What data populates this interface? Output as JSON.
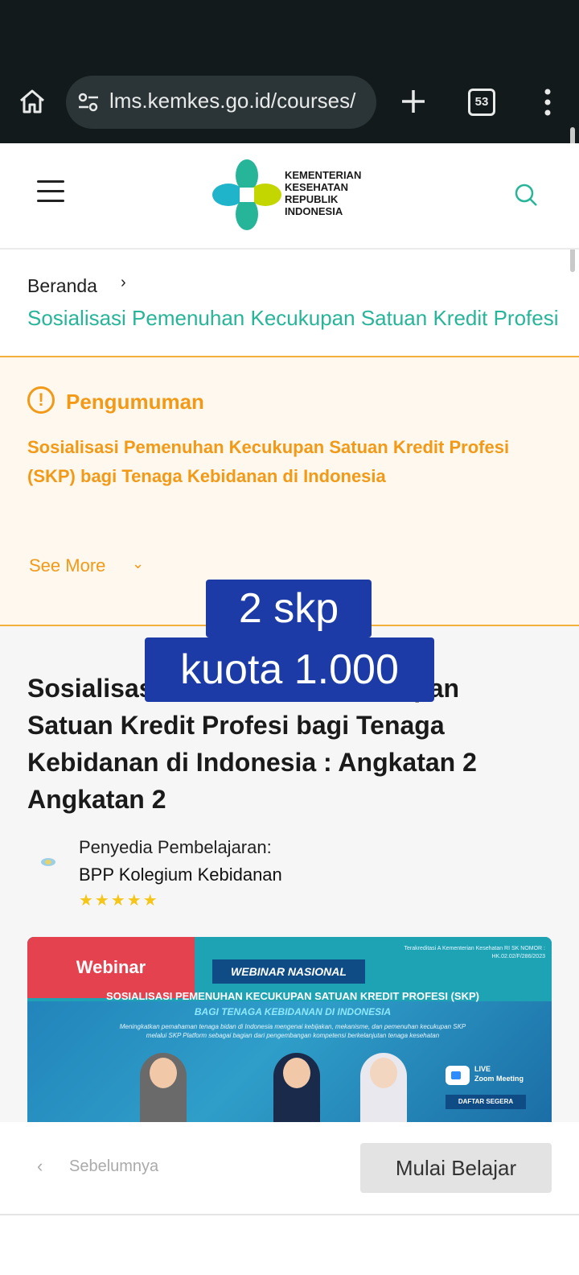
{
  "browser": {
    "url": "lms.kemkes.go.id/courses/",
    "tab_count": "53"
  },
  "header": {
    "logo_lines": [
      "KEMENTERIAN",
      "KESEHATAN",
      "REPUBLIK",
      "INDONESIA"
    ]
  },
  "breadcrumb": {
    "home": "Beranda",
    "current": "Sosialisasi Pemenuhan Kecukupan Satuan Kredit Profesi"
  },
  "announcement": {
    "title": "Pengumuman",
    "body": "Sosialisasi Pemenuhan Kecukupan Satuan Kredit Profesi (SKP) bagi Tenaga Kebidanan di Indonesia",
    "see_more": "See More"
  },
  "overlay": {
    "line1": "2 skp",
    "line2": "kuota 1.000"
  },
  "course": {
    "title": "Sosialisasi Pemenuhan Kecukupan Satuan Kredit Profesi bagi Tenaga Kebidanan di Indonesia : Angkatan 2 Angkatan 2",
    "provider_label": "Penyedia Pembelajaran:",
    "provider_name": "BPP Kolegium Kebidanan",
    "rating": 4.5,
    "rating_stars": "★★★★★"
  },
  "banner": {
    "badge": "Webinar",
    "headline": "WEBINAR NASIONAL",
    "accreditation": "Terakreditasi A Kementerian Kesehatan RI SK NOMOR : HK.02.02/F/286/2023",
    "subtitle": "SOSIALISASI PEMENUHAN KECUKUPAN SATUAN KREDIT PROFESI (SKP)",
    "subtitle2": "BAGI TENAGA KEBIDANAN DI INDONESIA",
    "description": "Meningkatkan pemahaman tenaga bidan di Indonesia mengenai kebijakan, mekanisme, dan pemenuhan kecukupan SKP melalui SKP Platform sebagai bagian dari pengembangan kompetensi berkelanjutan tenaga kesehatan",
    "live": "LIVE",
    "zoom": "Zoom Meeting",
    "cta": "DAFTAR SEGERA"
  },
  "footer_nav": {
    "prev": "Sebelumnya",
    "start": "Mulai Belajar"
  },
  "colors": {
    "accent_green": "#27b59a",
    "warning_orange": "#f29a18",
    "overlay_blue": "#1c3ba6",
    "badge_red": "#e5424f"
  }
}
